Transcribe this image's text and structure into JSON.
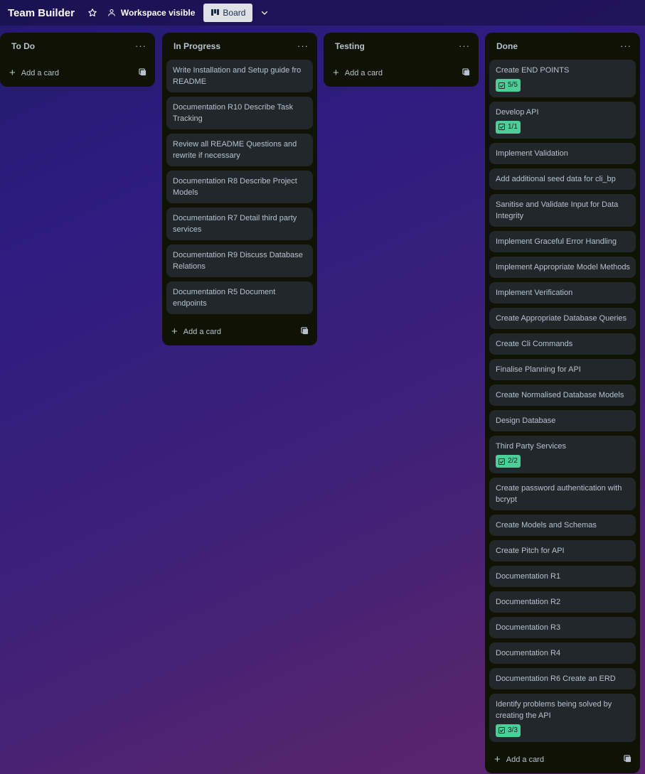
{
  "header": {
    "board_title": "Team Builder",
    "visibility_label": "Workspace visible",
    "view_label": "Board",
    "icons": [
      "star-icon",
      "workspace-icon",
      "board-icon",
      "chevron-down-icon"
    ]
  },
  "lists": [
    {
      "title": "To Do",
      "menu": "···",
      "add_card": "Add a card",
      "cards": []
    },
    {
      "title": "In Progress",
      "menu": "···",
      "add_card": "Add a card",
      "cards": [
        {
          "title": "Write Installation and Setup guide fro README"
        },
        {
          "title": "Documentation R10 Describe Task Tracking"
        },
        {
          "title": "Review all README Questions and rewrite if necessary"
        },
        {
          "title": "Documentation R8 Describe Project Models"
        },
        {
          "title": "Documentation R7 Detail third party services"
        },
        {
          "title": "Documentation R9 Discuss Database Relations"
        },
        {
          "title": "Documentation R5 Document endpoints"
        }
      ]
    },
    {
      "title": "Testing",
      "menu": "···",
      "add_card": "Add a card",
      "cards": []
    },
    {
      "title": "Done",
      "menu": "···",
      "add_card": "Add a card",
      "cards": [
        {
          "title": "Create END POINTS",
          "checklist": "5/5"
        },
        {
          "title": "Develop API",
          "checklist": "1/1"
        },
        {
          "title": "Implement Validation"
        },
        {
          "title": "Add additional seed data for cli_bp"
        },
        {
          "title": "Sanitise and Validate Input for Data Integrity"
        },
        {
          "title": "Implement Graceful Error Handling"
        },
        {
          "title": "Implement Appropriate Model Methods"
        },
        {
          "title": "Implement Verification"
        },
        {
          "title": "Create Appropriate Database Queries"
        },
        {
          "title": "Create Cli Commands"
        },
        {
          "title": "Finalise Planning for API"
        },
        {
          "title": "Create Normalised Database Models"
        },
        {
          "title": "Design Database"
        },
        {
          "title": "Third Party Services",
          "checklist": "2/2"
        },
        {
          "title": "Create password authentication with bcrypt"
        },
        {
          "title": "Create Models and Schemas"
        },
        {
          "title": "Create Pitch for API"
        },
        {
          "title": "Documentation R1"
        },
        {
          "title": "Documentation R2"
        },
        {
          "title": "Documentation R3"
        },
        {
          "title": "Documentation R4"
        },
        {
          "title": "Documentation R6 Create an ERD"
        },
        {
          "title": "Identify problems being solved by creating the API",
          "checklist": "3/3"
        }
      ]
    }
  ],
  "colors": {
    "list_bg": "#101204",
    "card_bg": "#22272b",
    "text": "#b6c2cf",
    "badge_bg": "#4bce97"
  }
}
